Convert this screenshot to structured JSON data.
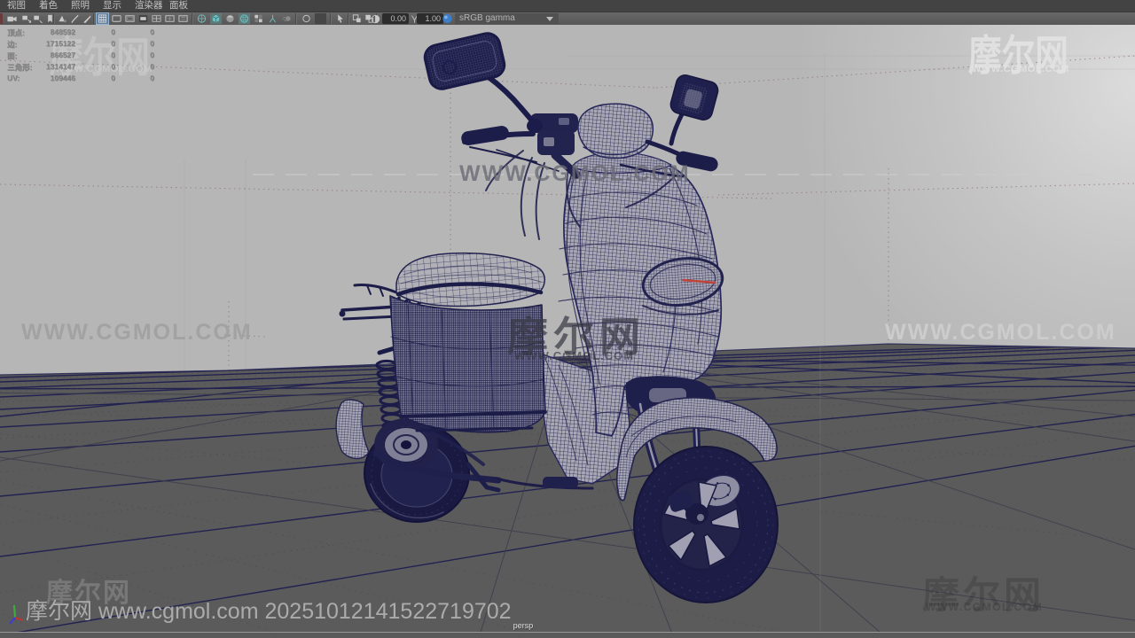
{
  "menubar": {
    "items": [
      "视图",
      "着色",
      "照明",
      "显示",
      "渲染器",
      "面板"
    ]
  },
  "toolbar": {
    "exposure_value": "0.00",
    "gamma_value": "1.00",
    "view_transform": "sRGB gamma",
    "icons": [
      "select-camera",
      "pan-zoom",
      "camera-attributes",
      "bookmark",
      "image-plane",
      "brush",
      "pencil",
      "grid-display",
      "film-gate",
      "resolution-gate",
      "gate-mask",
      "field-chart",
      "safe-action",
      "safe-title",
      "wireframe-mode",
      "shaded-mode",
      "textured-mode",
      "use-all-lights",
      "shadows",
      "screen-space-ao",
      "motion-blur",
      "multisample-aa",
      "sequence-time",
      "snapshot",
      "isolate-select",
      "plane-mode",
      "exposure",
      "gamma",
      "view-transform-ball"
    ]
  },
  "hud": {
    "rows": [
      {
        "label": "顶点:",
        "v1": "848592",
        "v2": "0",
        "v3": "0"
      },
      {
        "label": "边:",
        "v1": "1715122",
        "v2": "0",
        "v3": "0"
      },
      {
        "label": "面:",
        "v1": "866527",
        "v2": "0",
        "v3": "0"
      },
      {
        "label": "三角形:",
        "v1": "1314147",
        "v2": "0",
        "v3": "0"
      },
      {
        "label": "UV:",
        "v1": "109446",
        "v2": "0",
        "v3": "0"
      }
    ]
  },
  "watermarks": {
    "brand": "摩尔网",
    "site_upper": "WWW.CGMOL.COM",
    "bottom_text": "摩尔网 www.cgmol.com 20251012141522719702"
  },
  "viewport": {
    "camera_label": "persp"
  },
  "scene": {
    "model": "electric scooter wireframe",
    "background": "#b5b5b5",
    "floor": "#5b5b5c",
    "wire_color": "#23234e"
  }
}
